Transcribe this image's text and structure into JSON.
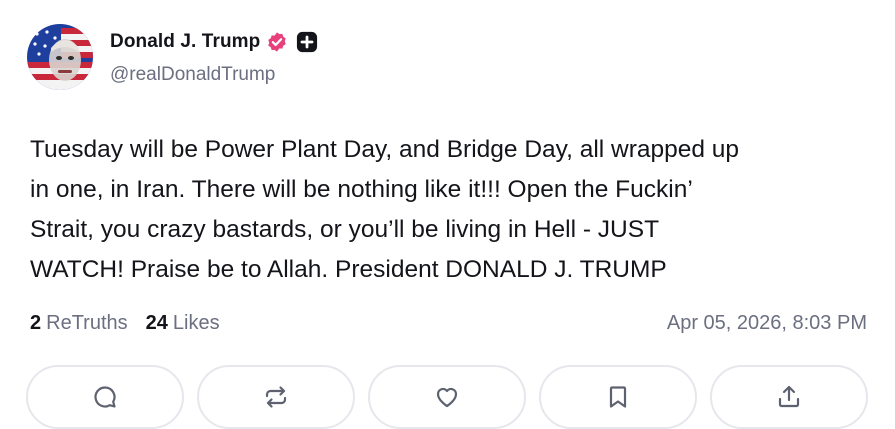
{
  "author": {
    "name": "Donald J. Trump",
    "handle": "@realDonaldTrump",
    "avatar": "avatar-image",
    "verified_icon": "verified-badge-icon",
    "extra_icon": "plus-badge-icon",
    "accent_color": "#e8407a"
  },
  "post": {
    "text": "Tuesday will be Power Plant Day, and Bridge Day, all wrapped up\nin one, in Iran. There will be nothing like it!!! Open the Fuckin’\nStrait, you crazy bastards, or you’ll be living in Hell - JUST\nWATCH! Praise be to Allah. President DONALD J. TRUMP"
  },
  "stats": {
    "retruths_count": "2",
    "retruths_label": "ReTruths",
    "likes_count": "24",
    "likes_label": "Likes",
    "timestamp": "Apr 05, 2026, 8:03 PM"
  },
  "actions": [
    {
      "icon": "comment-icon"
    },
    {
      "icon": "retruth-icon"
    },
    {
      "icon": "heart-icon"
    },
    {
      "icon": "bookmark-icon"
    },
    {
      "icon": "share-icon"
    }
  ]
}
